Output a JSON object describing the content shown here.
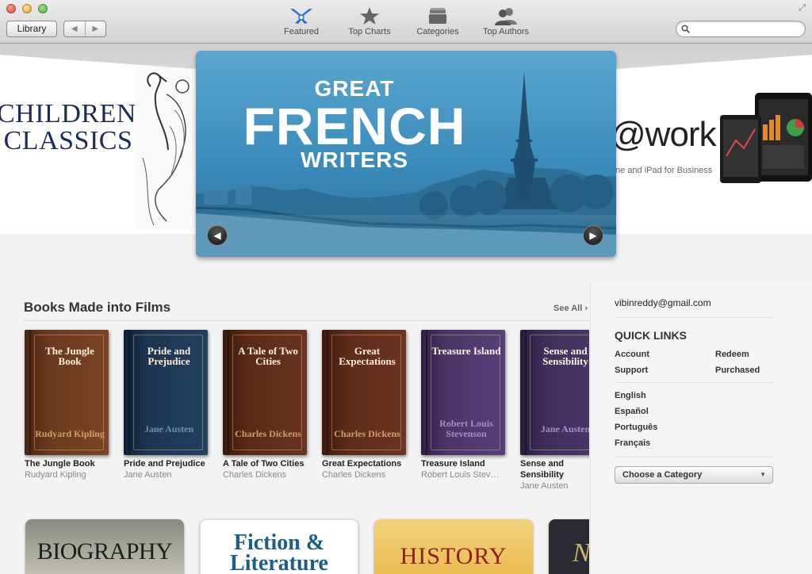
{
  "toolbar": {
    "library_label": "Library",
    "back_glyph": "◀",
    "forward_glyph": "▶",
    "search_placeholder": "",
    "tabs": [
      {
        "label": "Featured",
        "icon": "featured-icon"
      },
      {
        "label": "Top Charts",
        "icon": "star-icon"
      },
      {
        "label": "Categories",
        "icon": "categories-icon"
      },
      {
        "label": "Top Authors",
        "icon": "authors-icon"
      }
    ]
  },
  "banner": {
    "left_title": "CHILDREN'S CLASSICS",
    "hero_kicker": "GREAT",
    "hero_title": "FRENCH",
    "hero_sub": "WRITERS",
    "right_title": "@work",
    "right_sub": "ne and iPad for Business"
  },
  "section": {
    "title": "Books Made into Films",
    "see_all": "See All ›",
    "books": [
      {
        "cover_title": "The Jungle Book",
        "cover_author": "Rudyard Kipling",
        "title": "The Jungle Book",
        "author": "Rudyard Kipling",
        "color": "#6b3a1f"
      },
      {
        "cover_title": "Pride and Prejudice",
        "cover_author": "Jane Austen",
        "title": "Pride and Prejudice",
        "author": "Jane Austen",
        "color": "#1c3551"
      },
      {
        "cover_title": "A Tale of Two Cities",
        "cover_author": "Charles Dickens",
        "title": "A Tale of Two Cities",
        "author": "Charles Dickens",
        "color": "#5a2a17"
      },
      {
        "cover_title": "Great Expectations",
        "cover_author": "Charles Dickens",
        "title": "Great Expectations",
        "author": "Charles Dickens",
        "color": "#5e2b1a"
      },
      {
        "cover_title": "Treasure Island",
        "cover_author": "Robert Louis Stevenson",
        "title": "Treasure Island",
        "author": "Robert Louis Stev…",
        "color": "#4b3566"
      },
      {
        "cover_title": "Sense and Sensibility",
        "cover_author": "Jane Austen",
        "title": "Sense and Sensibility",
        "author": "Jane Austen",
        "color": "#3e2f5a"
      }
    ]
  },
  "categories": [
    {
      "label": "BIOGRAPHY"
    },
    {
      "label": "Fiction & Literature"
    },
    {
      "label": "HISTORY"
    },
    {
      "label": "N"
    }
  ],
  "sidebar": {
    "email": "vibinreddy@gmail.com",
    "quick_links_heading": "QUICK LINKS",
    "links": [
      "Account",
      "Redeem",
      "Support",
      "Purchased"
    ],
    "languages": [
      "English",
      "Español",
      "Português",
      "Français"
    ],
    "category_select": "Choose a Category"
  }
}
